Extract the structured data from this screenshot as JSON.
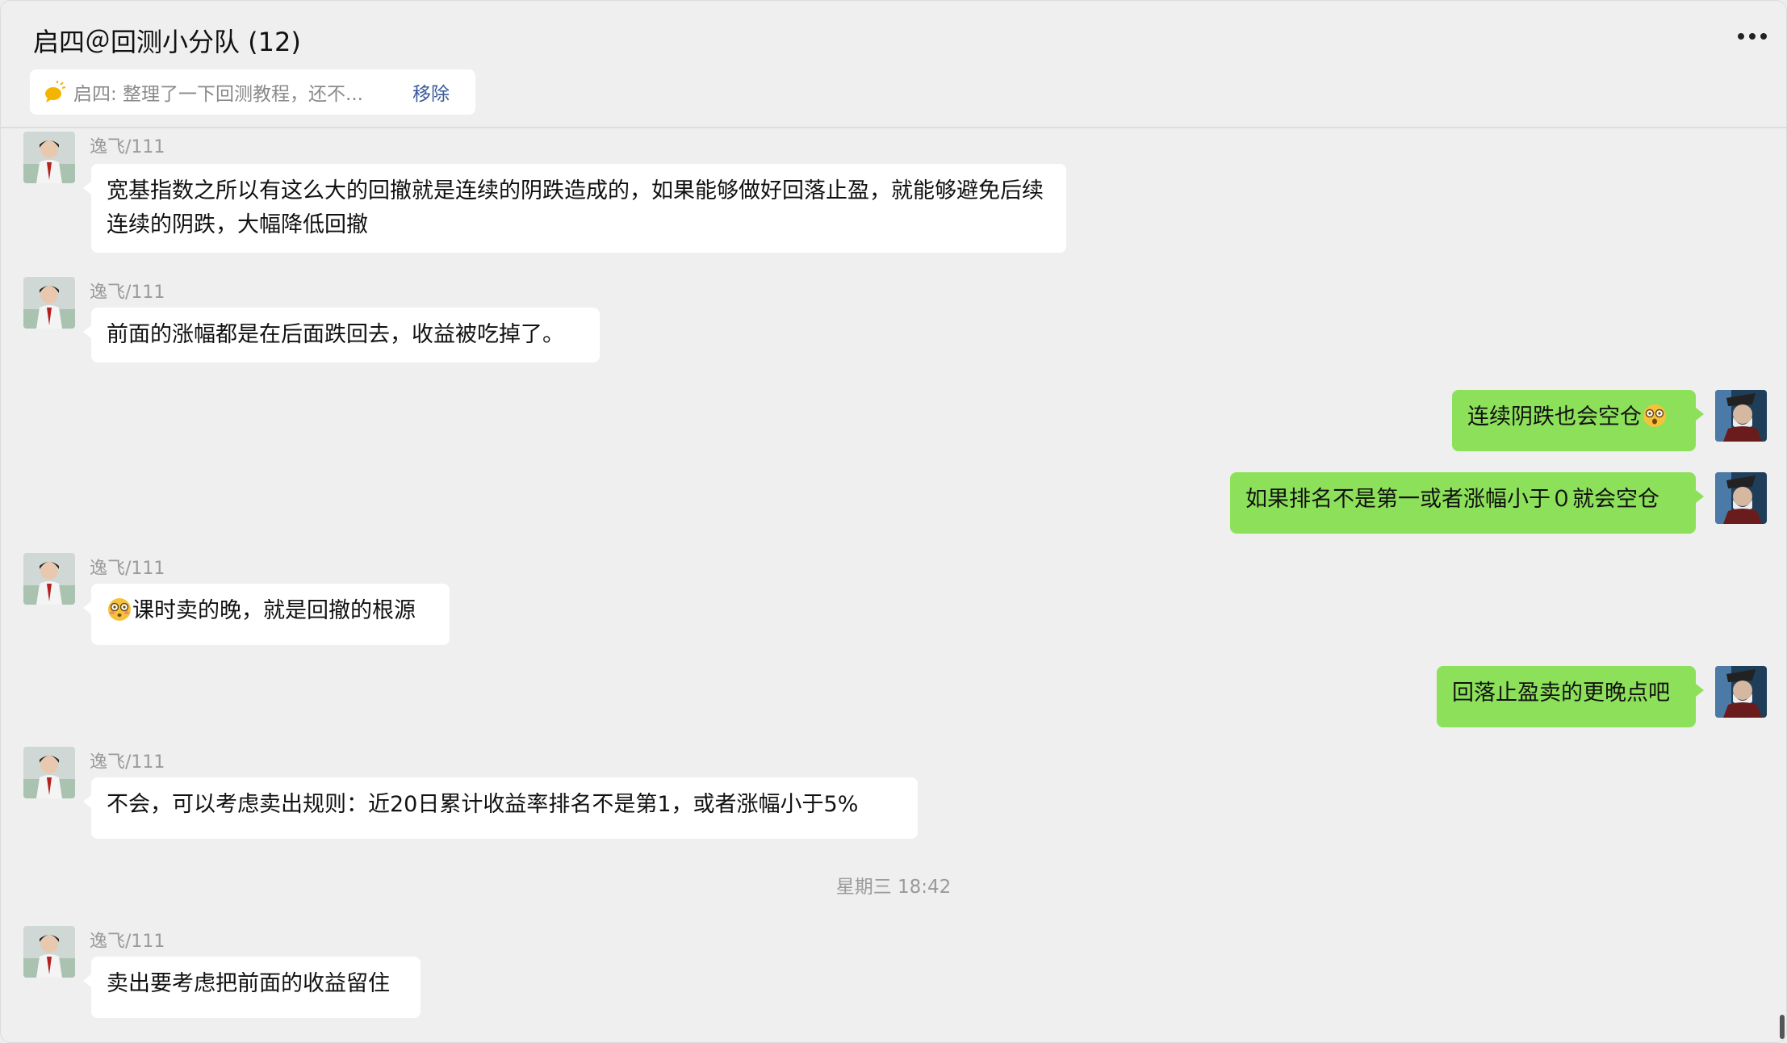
{
  "header": {
    "title": "启四＠回测小分队 (12)",
    "more_icon": "more-dots-icon"
  },
  "pinned": {
    "icon": "chat-bubble-icon",
    "text": "启四: 整理了一下回测教程，还不...",
    "remove_label": "移除"
  },
  "messages": [
    {
      "side": "left",
      "sender": "逸飞/111",
      "text": "宽基指数之所以有这么大的回撤就是连续的阴跌造成的，如果能够做好回落止盈，就能够避免后续连续的阴跌，大幅降低回撤"
    },
    {
      "side": "left",
      "sender": "逸飞/111",
      "text": "前面的涨幅都是在后面跌回去，收益被吃掉了。"
    },
    {
      "side": "right",
      "text": "连续阴跌也会空仓"
    },
    {
      "side": "right",
      "text": "如果排名不是第一或者涨幅小于０就会空仓"
    },
    {
      "side": "left",
      "sender": "逸飞/111",
      "text": "课时卖的晚，就是回撤的根源"
    },
    {
      "side": "right",
      "text": "回落止盈卖的更晚点吧"
    },
    {
      "side": "left",
      "sender": "逸飞/111",
      "text": "不会，可以考虑卖出规则：近20日累计收益率排名不是第1，或者涨幅小于5%"
    },
    {
      "side": "left",
      "sender": "逸飞/111",
      "text": "卖出要考虑把前面的收益留住"
    }
  ],
  "timestamp": "星期三 18:42",
  "colors": {
    "background": "#efefef",
    "bubble_left": "#ffffff",
    "bubble_right": "#8de05a",
    "link": "#3b5a9a"
  }
}
